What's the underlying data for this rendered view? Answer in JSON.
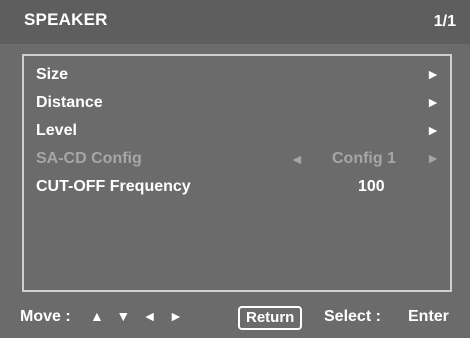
{
  "header": {
    "title": "SPEAKER",
    "page": "1/1"
  },
  "menu": {
    "items": [
      {
        "label": "Size",
        "arrow": "►"
      },
      {
        "label": "Distance",
        "arrow": "►"
      },
      {
        "label": "Level",
        "arrow": "►"
      },
      {
        "label": "SA-CD Config",
        "left_arrow": "◄",
        "value": "Config 1",
        "arrow": "►",
        "disabled": true
      },
      {
        "label": "CUT-OFF Frequency",
        "value": "100"
      }
    ]
  },
  "footer": {
    "move_label": "Move :",
    "arrows": [
      "▲",
      "▼",
      "◄",
      "►"
    ],
    "return_label": "Return",
    "select_label": "Select :",
    "enter_label": "Enter"
  },
  "colors": {
    "background": "#6b6b6b",
    "header_bg": "#5e5e5e",
    "text": "#ffffff",
    "disabled_text": "#a6a6a6",
    "frame": "#cfcfcf"
  }
}
